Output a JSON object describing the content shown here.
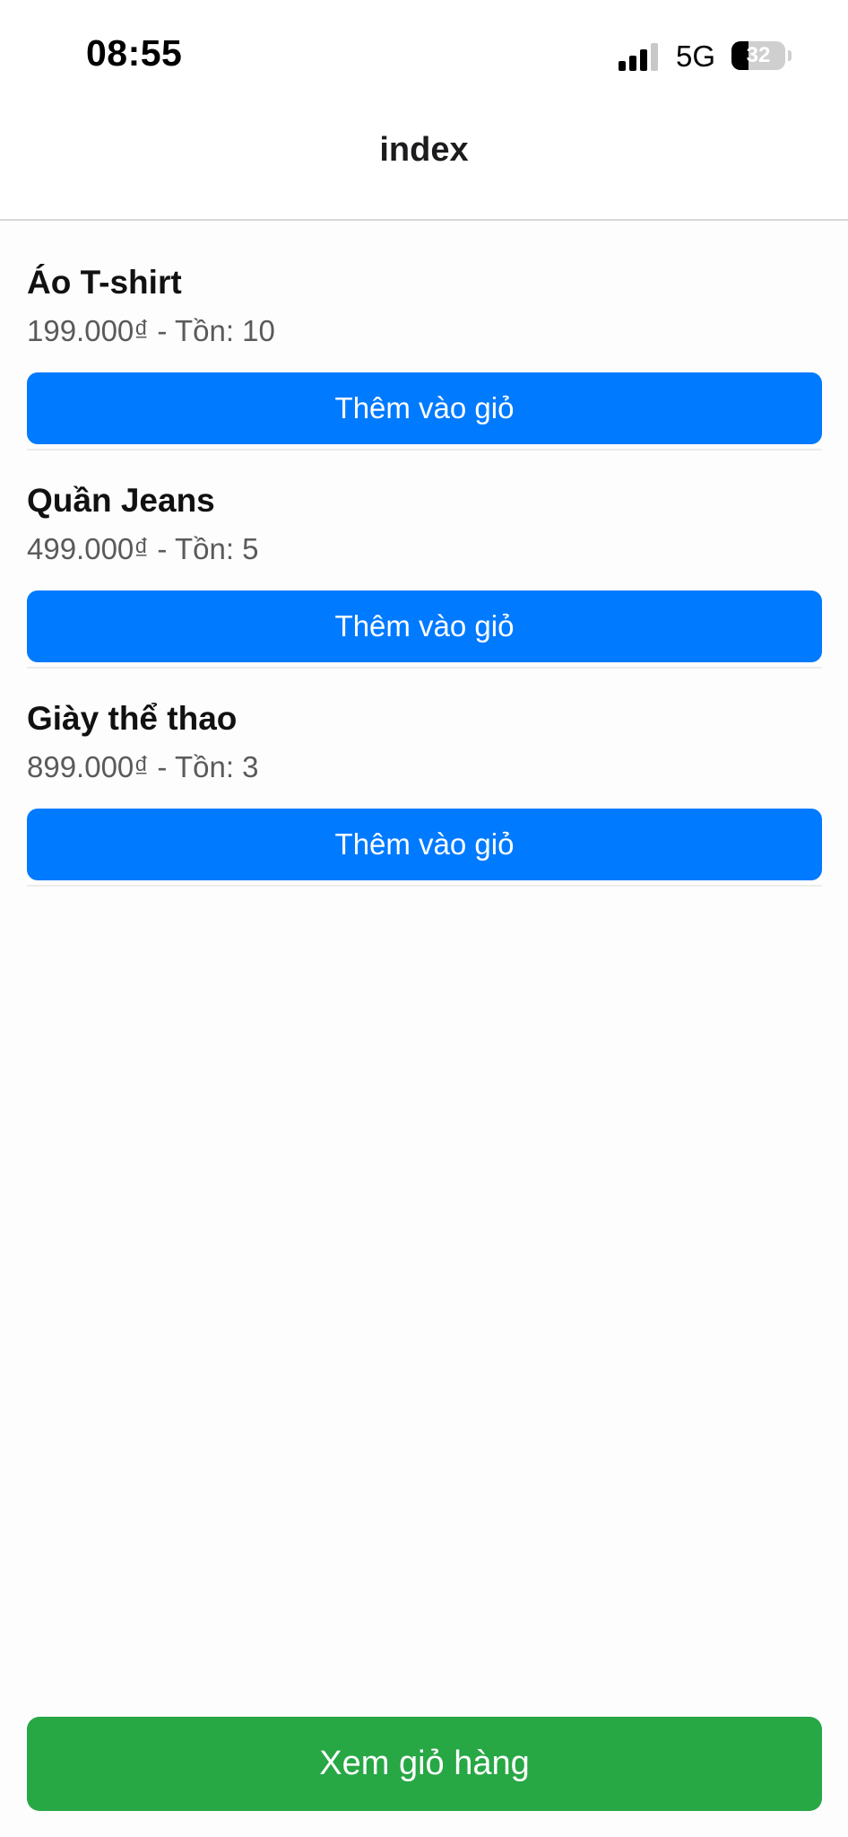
{
  "status_bar": {
    "time": "08:55",
    "network": "5G",
    "battery_level": "32",
    "signal_icon": "cellular-signal-icon",
    "signal_bars_active": 3,
    "signal_bars_total": 4,
    "battery_fraction": 0.32
  },
  "header": {
    "title": "index"
  },
  "products": [
    {
      "name": "Áo T-shirt",
      "meta": "199.000₫ - Tồn: 10",
      "button_label": "Thêm vào giỏ"
    },
    {
      "name": "Quần Jeans",
      "meta": "499.000₫ - Tồn: 5",
      "button_label": "Thêm vào giỏ"
    },
    {
      "name": "Giày thể thao",
      "meta": "899.000₫ - Tồn: 3",
      "button_label": "Thêm vào giỏ"
    }
  ],
  "footer": {
    "cart_button_label": "Xem giỏ hàng"
  },
  "colors": {
    "primary_button": "#007aff",
    "cart_button": "#28a745"
  }
}
